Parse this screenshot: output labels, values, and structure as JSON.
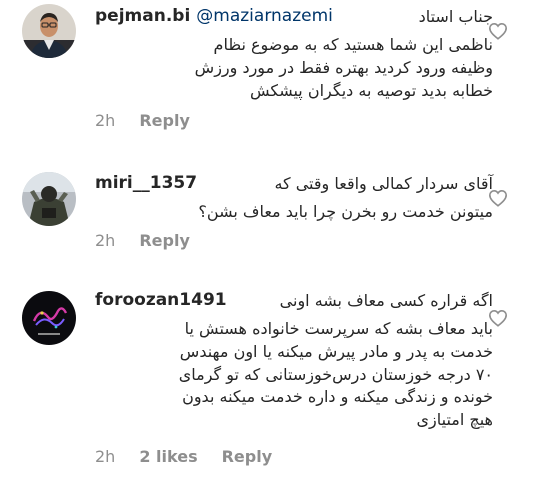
{
  "comments": [
    {
      "username": "pejman.bi",
      "mention": "@maziarnazemi",
      "first_line": "جناب استاد",
      "lines": [
        "ناظمی این شما هستید که به  موضوع نظام",
        "وظیفه ورود کردید بهتره فقط در مورد ورزش",
        "خطابه بدید توصیه به دیگران پیشکش"
      ],
      "time": "2h",
      "likes": "",
      "reply_label": "Reply",
      "avatar_icon": "profile-photo-man-glasses"
    },
    {
      "username": "miri__1357",
      "mention": "",
      "first_line": "آقای سردار کمالی واقعا وقتی که",
      "lines": [
        "میتونن خدمت رو بخرن چرا باید معاف بشن؟"
      ],
      "time": "2h",
      "likes": "",
      "reply_label": "Reply",
      "avatar_icon": "profile-photo-figure"
    },
    {
      "username": "foroozan1491",
      "mention": "",
      "first_line": "اگه قراره کسی معاف بشه اونی",
      "lines": [
        "باید معاف بشه که سرپرست خانواده هستش یا",
        "خدمت به پدر و مادر پیرش میکنه یا اون مهندس",
        "۷۰ درجه خوزستان درس‌خوزستانی که تو گرمای",
        "خونده و زندگی میکنه و داره خدمت میکنه بدون",
        "هیچ امتیازی"
      ],
      "time": "2h",
      "likes": "2 likes",
      "reply_label": "Reply",
      "avatar_icon": "profile-logo-calligraphy"
    }
  ],
  "colors": {
    "text": "#262626",
    "mention": "#003569",
    "meta": "#8e8e8e",
    "heart_stroke": "#8e8e8e"
  },
  "icons": {
    "like": "heart-outline-icon"
  }
}
